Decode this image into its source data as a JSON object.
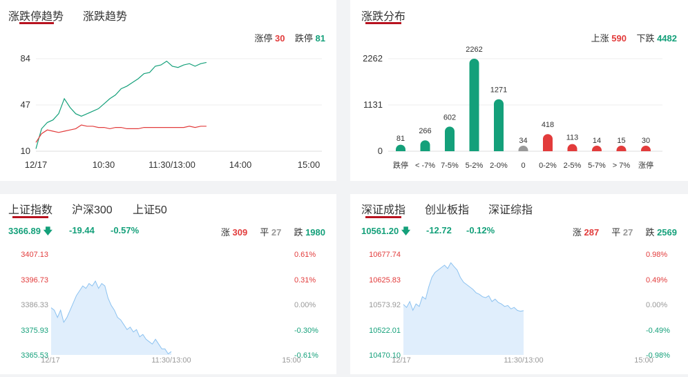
{
  "trend_panel": {
    "tabs": [
      "涨跌停趋势",
      "涨跌趋势"
    ],
    "limit_up_label": "涨停",
    "limit_up_value": "30",
    "limit_down_label": "跌停",
    "limit_down_value": "81",
    "y_ticks": [
      "84",
      "47",
      "10"
    ],
    "x_ticks": [
      "12/17",
      "10:30",
      "11:30/13:00",
      "14:00",
      "15:00"
    ]
  },
  "dist_panel": {
    "tabs": [
      "涨跌分布"
    ],
    "up_label": "上涨",
    "up_value": "590",
    "down_label": "下跌",
    "down_value": "4482",
    "y_ticks": [
      "2262",
      "1131",
      "0"
    ]
  },
  "sh_panel": {
    "tabs": [
      "上证指数",
      "沪深300",
      "上证50"
    ],
    "price": "3366.89",
    "change": "-19.44",
    "change_pct": "-0.57%",
    "up_label": "涨",
    "up_count": "309",
    "flat_label": "平",
    "flat_count": "27",
    "down_label": "跌",
    "down_count": "1980",
    "left_ticks": [
      "3407.13",
      "3396.73",
      "3386.33",
      "3375.93",
      "3365.53"
    ],
    "right_ticks": [
      "0.61%",
      "0.31%",
      "0.00%",
      "-0.30%",
      "-0.61%"
    ],
    "x_ticks": [
      "12/17",
      "11:30/13:00",
      "15:00"
    ]
  },
  "sz_panel": {
    "tabs": [
      "深证成指",
      "创业板指",
      "深证综指"
    ],
    "price": "10561.20",
    "change": "-12.72",
    "change_pct": "-0.12%",
    "up_label": "涨",
    "up_count": "287",
    "flat_label": "平",
    "flat_count": "27",
    "down_label": "跌",
    "down_count": "2569",
    "left_ticks": [
      "10677.74",
      "10625.83",
      "10573.92",
      "10522.01",
      "10470.10"
    ],
    "right_ticks": [
      "0.98%",
      "0.49%",
      "0.00%",
      "-0.49%",
      "-0.98%"
    ],
    "x_ticks": [
      "12/17",
      "11:30/13:00",
      "15:00"
    ]
  },
  "colors": {
    "red": "#e23b3b",
    "green": "#14a07a",
    "gray": "#999999",
    "area_fill": "#e0eefc",
    "area_line": "#8cc2f0",
    "tab_underline": "#b8121f"
  },
  "chart_data": [
    {
      "type": "line",
      "x_range": [
        "09:30",
        "15:00"
      ],
      "ylim": [
        10,
        84
      ],
      "series": [
        {
          "name": "跌停",
          "color": "#14a07a",
          "x": [
            "09:30",
            "09:35",
            "09:40",
            "09:45",
            "09:50",
            "09:55",
            "10:00",
            "10:05",
            "10:10",
            "10:15",
            "10:20",
            "10:25",
            "10:30",
            "10:35",
            "10:40",
            "10:45",
            "10:50",
            "10:55",
            "11:00",
            "11:05",
            "11:10",
            "11:15",
            "11:20",
            "11:25",
            "11:30",
            "13:05",
            "13:10",
            "13:15",
            "13:20",
            "13:25",
            "13:30"
          ],
          "values": [
            12,
            28,
            33,
            35,
            40,
            52,
            45,
            40,
            38,
            40,
            42,
            44,
            48,
            52,
            55,
            60,
            62,
            65,
            68,
            72,
            73,
            78,
            79,
            82,
            78,
            77,
            79,
            80,
            78,
            80,
            81
          ]
        },
        {
          "name": "涨停",
          "color": "#e23b3b",
          "x": [
            "09:30",
            "09:35",
            "09:40",
            "09:45",
            "09:50",
            "09:55",
            "10:00",
            "10:05",
            "10:10",
            "10:15",
            "10:20",
            "10:25",
            "10:30",
            "10:35",
            "10:40",
            "10:45",
            "10:50",
            "10:55",
            "11:00",
            "11:05",
            "11:10",
            "11:15",
            "11:20",
            "11:25",
            "11:30",
            "13:05",
            "13:10",
            "13:15",
            "13:20",
            "13:25",
            "13:30"
          ],
          "values": [
            17,
            24,
            27,
            26,
            25,
            26,
            27,
            28,
            31,
            30,
            30,
            29,
            29,
            28,
            29,
            29,
            28,
            28,
            28,
            29,
            29,
            29,
            29,
            29,
            29,
            29,
            29,
            30,
            29,
            30,
            30
          ]
        }
      ]
    },
    {
      "type": "bar",
      "categories": [
        "跌停",
        "< -7%",
        "7-5%",
        "5-2%",
        "2-0%",
        "0",
        "0-2%",
        "2-5%",
        "5-7%",
        "> 7%",
        "涨停"
      ],
      "values": [
        81,
        266,
        602,
        2262,
        1271,
        34,
        418,
        113,
        14,
        15,
        30
      ],
      "colors": [
        "#14a07a",
        "#14a07a",
        "#14a07a",
        "#14a07a",
        "#14a07a",
        "#999999",
        "#e23b3b",
        "#e23b3b",
        "#e23b3b",
        "#e23b3b",
        "#e23b3b"
      ],
      "ylim": [
        0,
        2262
      ]
    },
    {
      "type": "area",
      "ylim": [
        3365.53,
        3407.13
      ],
      "x_range": [
        "09:30",
        "15:00"
      ],
      "values": [
        3385,
        3384,
        3381,
        3384,
        3379,
        3381,
        3384,
        3387,
        3390,
        3392,
        3394,
        3393,
        3395,
        3394,
        3396,
        3393,
        3395,
        3394,
        3389,
        3386,
        3384,
        3381,
        3380,
        3378,
        3376,
        3377,
        3375,
        3376,
        3373,
        3374,
        3372,
        3371,
        3370,
        3372,
        3370,
        3368,
        3368,
        3366,
        3366.9
      ],
      "line_color": "#8cc2f0",
      "fill_color": "#e0eefc"
    },
    {
      "type": "area",
      "ylim": [
        10470.1,
        10677.74
      ],
      "x_range": [
        "09:30",
        "15:00"
      ],
      "values": [
        10574,
        10568,
        10580,
        10562,
        10575,
        10570,
        10590,
        10585,
        10610,
        10630,
        10640,
        10645,
        10650,
        10655,
        10648,
        10660,
        10652,
        10645,
        10630,
        10620,
        10615,
        10610,
        10605,
        10598,
        10595,
        10590,
        10588,
        10592,
        10580,
        10585,
        10578,
        10575,
        10570,
        10572,
        10565,
        10568,
        10562,
        10560,
        10561.2
      ],
      "line_color": "#8cc2f0",
      "fill_color": "#e0eefc"
    }
  ]
}
